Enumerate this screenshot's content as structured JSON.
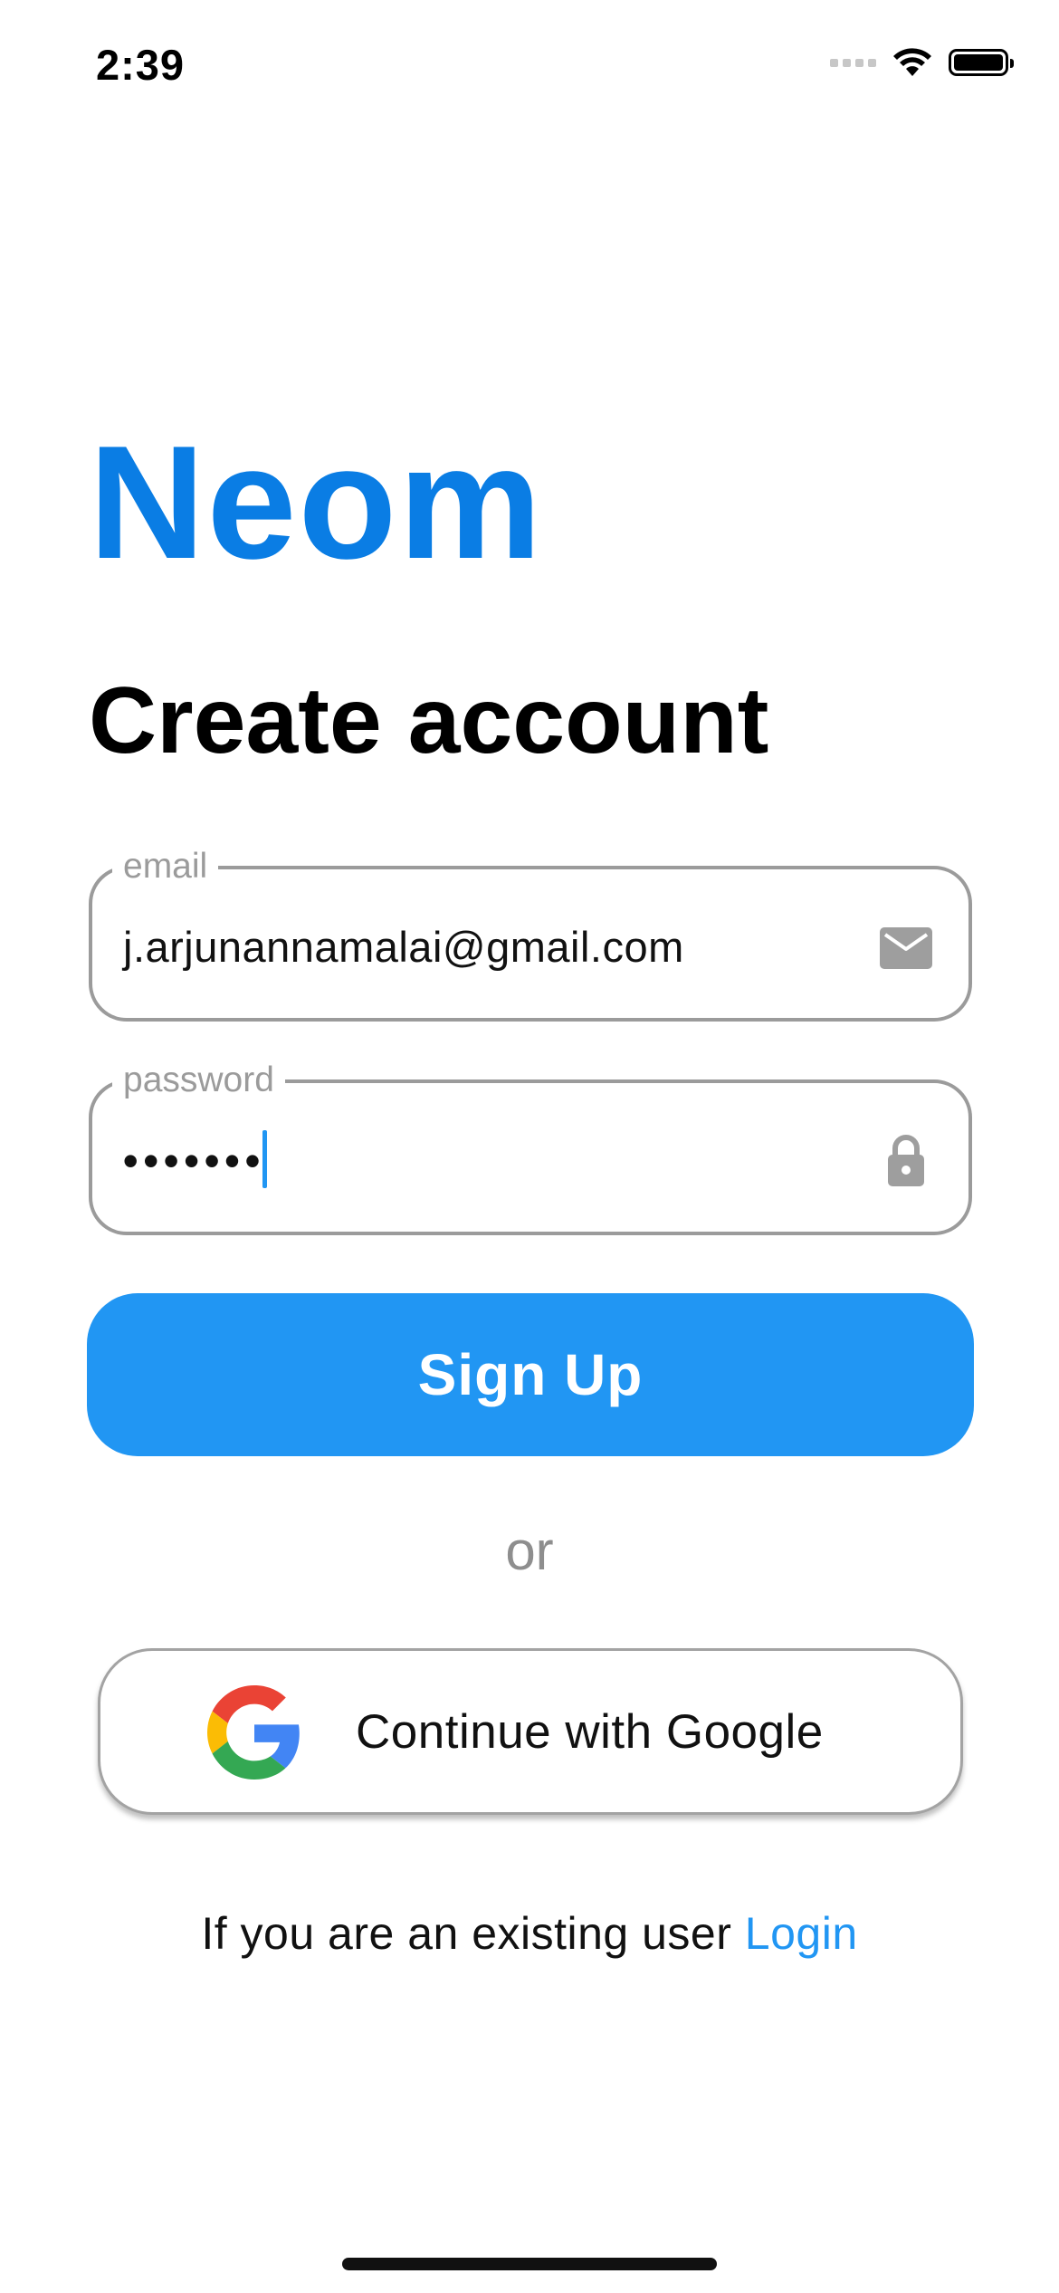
{
  "status_bar": {
    "time": "2:39",
    "icons": [
      "signal-icon",
      "wifi-icon",
      "battery-icon"
    ]
  },
  "brand": {
    "name": "Neom",
    "color": "#0a7de4"
  },
  "page": {
    "title": "Create account"
  },
  "form": {
    "email": {
      "label": "email",
      "value": "j.arjunannamalai@gmail.com",
      "icon": "mail-icon"
    },
    "password": {
      "label": "password",
      "value": "•••••••",
      "icon": "lock-icon"
    },
    "submit_label": "Sign Up"
  },
  "divider": {
    "text": "or"
  },
  "google": {
    "label": "Continue with Google",
    "icon": "google-logo-icon"
  },
  "footer": {
    "prompt": "If you are an existing user ",
    "link_label": "Login"
  },
  "colors": {
    "primary": "#2196f3",
    "outline": "#9b9b9b",
    "muted_text": "#8e8e8e"
  }
}
